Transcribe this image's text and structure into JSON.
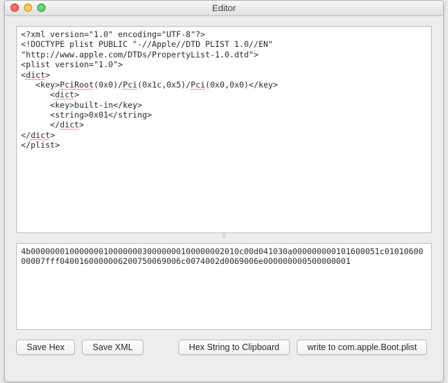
{
  "window": {
    "title": "Editor"
  },
  "editor": {
    "xml_content": "<?xml version=\"1.0\" encoding=\"UTF-8\"?>\n<!DOCTYPE plist PUBLIC \"-//Apple//DTD PLIST 1.0//EN\" \"http://www.apple.com/DTDs/PropertyList-1.0.dtd\">\n<plist version=\"1.0\">\n<dict>\n   <key>PciRoot(0x0)/Pci(0x1c,0x5)/Pci(0x0,0x0)</key>\n      <dict>\n      <key>built-in</key>\n      <string>0x01</string>\n      </dict>\n</dict>\n</plist>",
    "spellcheck_words": [
      "PciRoot",
      "Pci",
      "Pci",
      "dict"
    ],
    "hex_content": "4b0000000100000001000000030000000100000002010c00d041030a000000000101600051c0101060000007fff0400160000006200750069006c0074002d0069006e000000000500000001"
  },
  "buttons": {
    "save_hex": "Save Hex",
    "save_xml": "Save XML",
    "hex_to_clipboard": "Hex String to Clipboard",
    "write_boot_plist": "write to com.apple.Boot.plist"
  }
}
